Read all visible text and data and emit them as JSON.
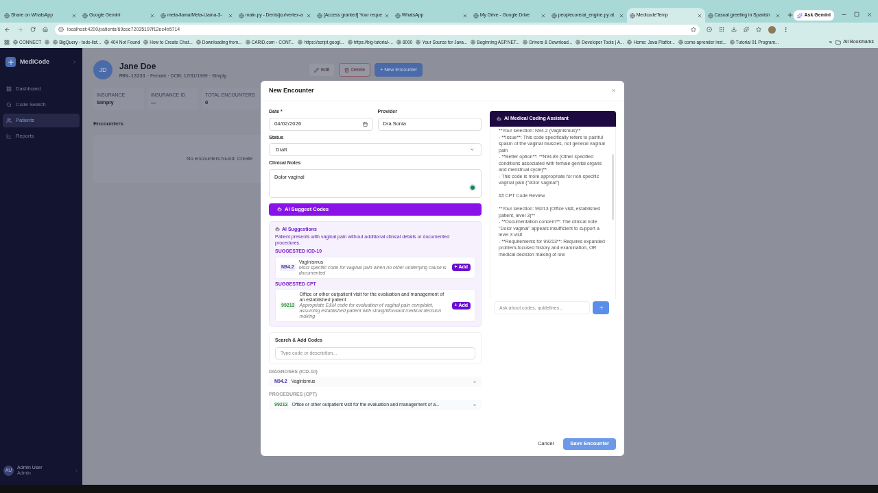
{
  "browser": {
    "tabs": [
      {
        "title": "Share on WhatsApp",
        "selected": false
      },
      {
        "title": "Google Gemini",
        "selected": false
      },
      {
        "title": "meta-llama/Meta-Llama-3-",
        "selected": false
      },
      {
        "title": "main.py - Denisijcu/vertex-a",
        "selected": false
      },
      {
        "title": "[Access granted] Your reque",
        "selected": false
      },
      {
        "title": "WhatsApp",
        "selected": false
      },
      {
        "title": "My Drive - Google Drive",
        "selected": false
      },
      {
        "title": "peoplecore/ai_engine.py at",
        "selected": false
      },
      {
        "title": "MedicodeTemp",
        "selected": true
      },
      {
        "title": "Casual greeting in Spanish",
        "selected": false
      }
    ],
    "ask_gemini": "Ask Gemini",
    "address": "localhost:4200/patients/69cee72035197f12ec4b5714",
    "bookmarks": [
      "CONNECT",
      "BigQuery - todo-list...",
      "404 Not Found",
      "How to Create Chat...",
      "Downloading from...",
      "CARiD.com - CONT...",
      "https://script.googl...",
      "https://big-tutorial-...",
      "8000",
      "Your Source for Java...",
      "Beginning ASP.NET...",
      "Drivers & Download...",
      "Developer Tools | A...",
      "Home: Java Platfor...",
      "como aprender inst...",
      "Tutorial 01 Program..."
    ],
    "more_bookmarks": "»",
    "all_bookmarks": "All Bookmarks"
  },
  "sidebar": {
    "brand": "MediCode",
    "items": [
      {
        "label": "Dashboard",
        "kind": "dashboard",
        "selected": false
      },
      {
        "label": "Code Search",
        "kind": "search",
        "selected": false
      },
      {
        "label": "Patients",
        "kind": "patients",
        "selected": true
      },
      {
        "label": "Reports",
        "kind": "reports",
        "selected": false
      }
    ],
    "user": {
      "initials": "AU",
      "name": "Admin User",
      "role": "Admin"
    }
  },
  "patient": {
    "initials": "JD",
    "name": "Jane Doe",
    "mrn": "MRN-13333",
    "details": "· Female · DOB: 12/31/1999 · Simply",
    "actions": [
      {
        "label": "Edit",
        "kind": "edit"
      },
      {
        "label": "Delete",
        "kind": "delete"
      },
      {
        "label": "+ New Encounter",
        "kind": "primary"
      }
    ],
    "stats": [
      {
        "label": "INSURANCE",
        "value": "Simply"
      },
      {
        "label": "INSURANCE ID",
        "value": "—"
      },
      {
        "label": "TOTAL ENCOUNTERS",
        "value": "0"
      }
    ],
    "encounters_title": "Encounters",
    "encounters_empty": "No encounters found. Create"
  },
  "modal": {
    "title": "New Encounter",
    "close": "×",
    "date": {
      "label": "Date *",
      "value": "04/02/2026"
    },
    "provider": {
      "label": "Provider",
      "value": "Dra Sonia"
    },
    "status": {
      "label": "Status",
      "value": "Draft"
    },
    "notes": {
      "label": "Clinical Notes",
      "value": "Dolor vaginal"
    },
    "suggest_button": "AI Suggest Codes",
    "suggestions": {
      "title": "AI Suggestions",
      "summary": "Patient presents with vaginal pain without additional clinical details or documented procedures.",
      "groups": [
        {
          "heading": "SUGGESTED ICD-10",
          "items": [
            {
              "code": "N94.2",
              "kind": "icd",
              "title": "Vaginismus",
              "reason": "Most specific code for vaginal pain when no other underlying cause is documented",
              "add": "+ Add"
            }
          ]
        },
        {
          "heading": "SUGGESTED CPT",
          "items": [
            {
              "code": "99213",
              "kind": "cpt",
              "title": "Office or other outpatient visit for the evaluation and management of an established patient",
              "reason": "Appropriate E&M code for evaluation of vaginal pain complaint, assuming established patient with straightforward medical decision making",
              "add": "+ Add"
            }
          ]
        }
      ]
    },
    "search": {
      "title": "Search & Add Codes",
      "placeholder": "Type code or description..."
    },
    "selected_groups": [
      {
        "heading": "DIAGNOSES (ICD-10)",
        "items": [
          {
            "code": "N94.2",
            "kind": "icd",
            "text": "Vaginismus",
            "remove": "×"
          }
        ]
      },
      {
        "heading": "PROCEDURES (CPT)",
        "items": [
          {
            "code": "99213",
            "kind": "cpt",
            "text": "Office or other outpatient visit for the evaluation and management of a...",
            "remove": "×"
          }
        ]
      }
    ],
    "assistant": {
      "title": "AI Medical Coding Assistant",
      "message": "**Your selection: N94.2 (Vaginismus)**\n- **Issue**: This code specifically refers to painful spasm of the vaginal muscles, not general vaginal pain\n- **Better option**: **N94.89 (Other specified conditions associated with female genital organs and menstrual cycle)**\n- This code is more appropriate for non-specific vaginal pain (\"dolor vaginal\")\n\n## CPT Code Review\n\n**Your selection: 99213 (Office visit, established patient, level 3)**\n- **Documentation concern**: The clinical note \"Dolor vaginal\" appears insufficient to support a level 3 visit\n- **Requirements for 99213**: Requires expanded problem-focused history and examination, OR medical decision making of low",
      "placeholder": "Ask about codes, guidelines..."
    },
    "cancel": "Cancel",
    "save": "Save Encounter"
  }
}
